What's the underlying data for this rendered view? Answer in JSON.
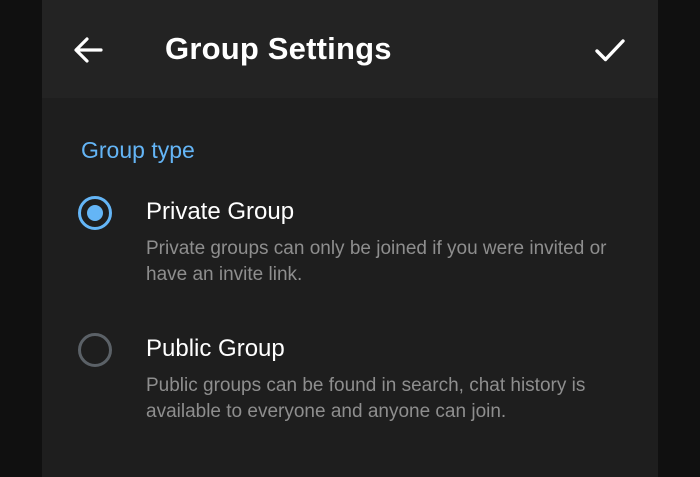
{
  "colors": {
    "background": "#1e1e1e",
    "toolbar": "#232323",
    "accent": "#64b5f6",
    "text_primary": "#ffffff",
    "text_secondary": "#8e8e8e",
    "radio_inactive": "#5b6167"
  },
  "toolbar": {
    "back_icon": "arrow-left-icon",
    "title": "Group Settings",
    "done_icon": "checkmark-icon"
  },
  "section": {
    "title": "Group type"
  },
  "options": [
    {
      "label": "Private Group",
      "description": "Private groups can only be joined if you were invited or have an invite link.",
      "selected": true
    },
    {
      "label": "Public Group",
      "description": "Public groups can be found in search, chat history is available to everyone and anyone can join.",
      "selected": false
    }
  ]
}
